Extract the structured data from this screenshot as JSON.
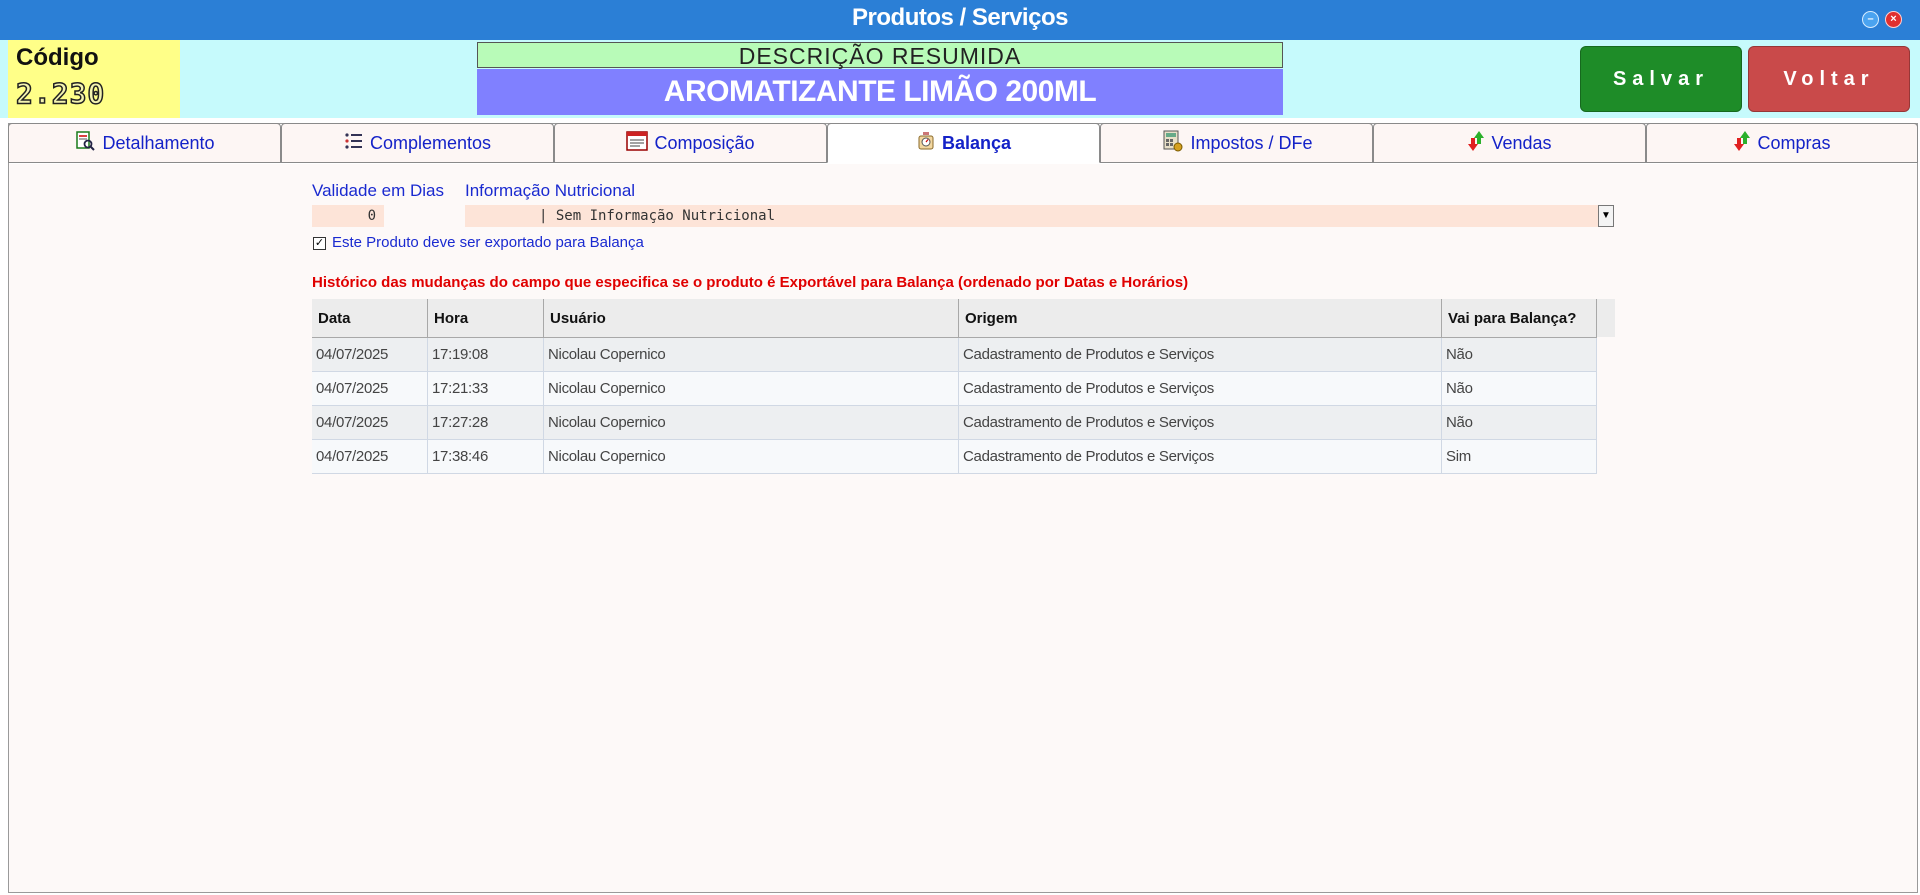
{
  "window": {
    "title": "Produtos / Serviços"
  },
  "header": {
    "code_label": "Código",
    "code_value": "2.230",
    "description_label": "DESCRIÇÃO RESUMIDA",
    "description_value": "AROMATIZANTE LIMÃO 200ML",
    "save_label": "Salvar",
    "back_label": "Voltar"
  },
  "tabs": [
    {
      "label": "Detalhamento",
      "icon": "document-search-icon"
    },
    {
      "label": "Complementos",
      "icon": "list-icon"
    },
    {
      "label": "Composição",
      "icon": "composition-icon"
    },
    {
      "label": "Balança",
      "icon": "scale-icon",
      "active": true
    },
    {
      "label": "Impostos / DFe",
      "icon": "tax-icon"
    },
    {
      "label": "Vendas",
      "icon": "up-down-arrows-icon"
    },
    {
      "label": "Compras",
      "icon": "up-down-arrows-icon"
    }
  ],
  "form": {
    "validity_label": "Validade em Dias",
    "validity_value": "0",
    "nutrition_label": "Informação Nutricional",
    "nutrition_value": "| Sem Informação Nutricional",
    "export_checkbox_label": "Este Produto deve ser exportado para Balança",
    "export_checked": true
  },
  "history": {
    "title": "Histórico das mudanças do campo que especifica se o produto é Exportável para Balança (ordenado por Datas e Horários)",
    "columns": [
      "Data",
      "Hora",
      "Usuário",
      "Origem",
      "Vai para Balança?"
    ],
    "rows": [
      [
        "04/07/2025",
        "17:19:08",
        "Nicolau Copernico",
        "Cadastramento de Produtos e Serviços",
        "Não"
      ],
      [
        "04/07/2025",
        "17:21:33",
        "Nicolau Copernico",
        "Cadastramento de Produtos e Serviços",
        "Não"
      ],
      [
        "04/07/2025",
        "17:27:28",
        "Nicolau Copernico",
        "Cadastramento de Produtos e Serviços",
        "Não"
      ],
      [
        "04/07/2025",
        "17:38:46",
        "Nicolau Copernico",
        "Cadastramento de Produtos e Serviços",
        "Sim"
      ]
    ]
  },
  "colors": {
    "titlebar": "#2b7fd6",
    "save": "#1e8c28",
    "back": "#c94a4a",
    "accent_text": "#1a2ad0",
    "alert_text": "#e00000"
  }
}
